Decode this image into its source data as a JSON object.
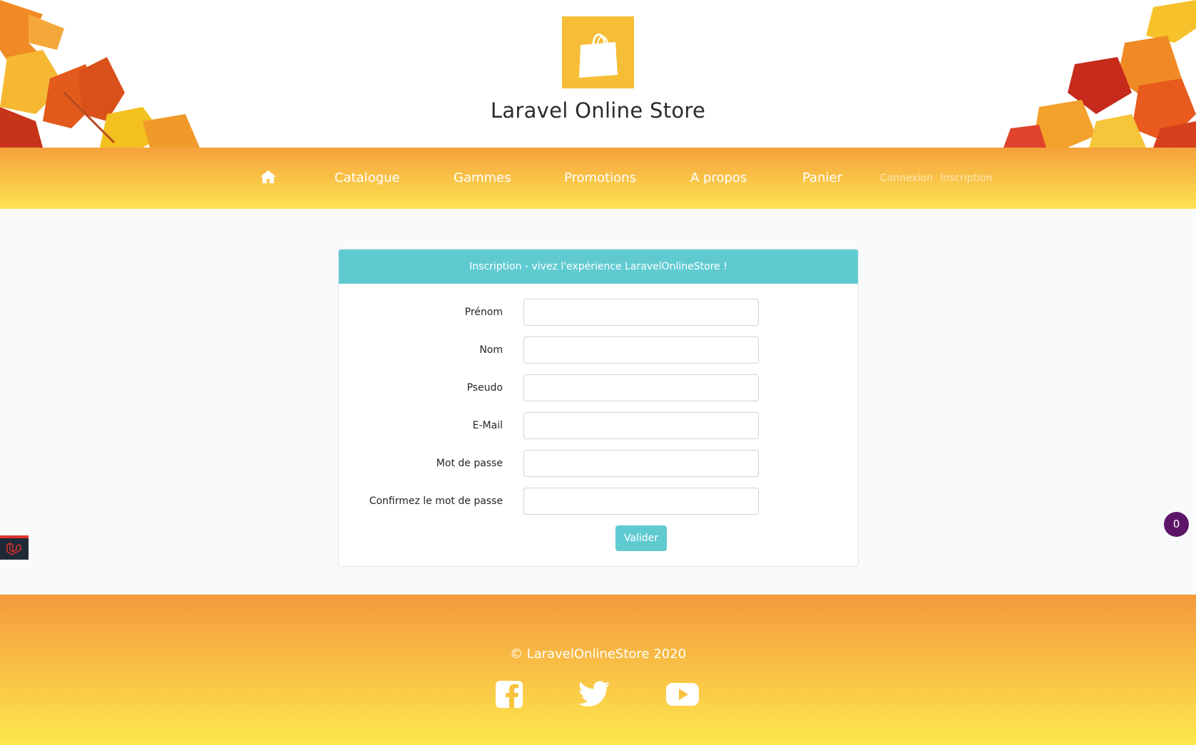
{
  "header": {
    "title": "Laravel Online Store",
    "logo_icon": "shopping-bag-icon",
    "logo_color": "#f6bd36"
  },
  "nav": {
    "home_icon": "home-icon",
    "items": [
      {
        "label": "Catalogue"
      },
      {
        "label": "Gammes"
      },
      {
        "label": "Promotions"
      },
      {
        "label": "A propos"
      },
      {
        "label": "Panier"
      }
    ],
    "login": "Connexion",
    "register": "Inscription"
  },
  "form": {
    "heading": "Inscription - vivez l'expérience LaravelOnlineStore !",
    "fields": [
      {
        "label": "Prénom",
        "value": ""
      },
      {
        "label": "Nom",
        "value": ""
      },
      {
        "label": "Pseudo",
        "value": ""
      },
      {
        "label": "E-Mail",
        "value": ""
      },
      {
        "label": "Mot de passe",
        "value": ""
      },
      {
        "label": "Confirmez le mot de passe",
        "value": ""
      }
    ],
    "submit_label": "Valider"
  },
  "footer": {
    "copyright": "© LaravelOnlineStore 2020",
    "social": [
      "facebook-icon",
      "twitter-icon",
      "youtube-icon"
    ]
  },
  "cart_count": "0",
  "colors": {
    "accent": "#5fcbd1",
    "nav_top": "#f5a13c",
    "nav_bottom": "#fde352",
    "badge": "#5d1568"
  }
}
